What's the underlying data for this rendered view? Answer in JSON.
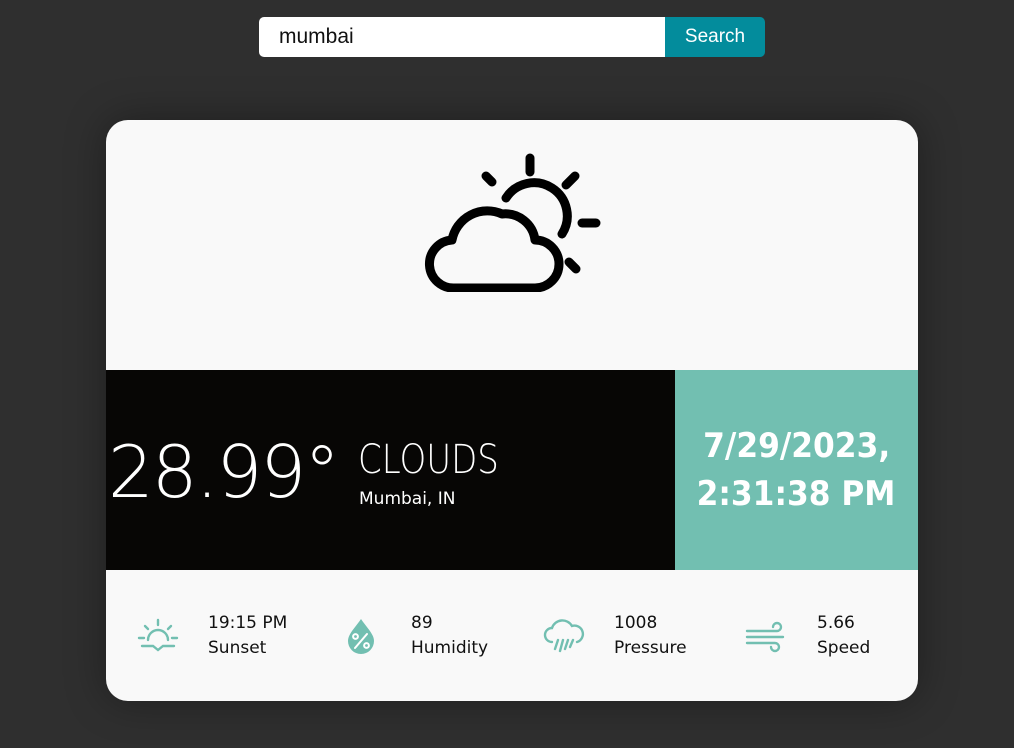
{
  "search": {
    "value": "mumbai",
    "button_label": "Search"
  },
  "weather": {
    "icon": "partly-cloudy-icon",
    "temperature": "28.99°",
    "condition": "CLOUDS",
    "location": "Mumbai, IN",
    "date": "7/29/2023,",
    "time": "2:31:38 PM"
  },
  "stats": [
    {
      "icon": "sunset-icon",
      "value": "19:15 PM",
      "label": "Sunset"
    },
    {
      "icon": "humidity-icon",
      "value": "89",
      "label": "Humidity"
    },
    {
      "icon": "pressure-icon",
      "value": "1008",
      "label": "Pressure"
    },
    {
      "icon": "wind-icon",
      "value": "5.66",
      "label": "Speed"
    }
  ],
  "colors": {
    "background": "#2f2f2f",
    "card": "#f9f9f9",
    "temp_block": "#070605",
    "accent_teal": "#72bfb1",
    "search_button": "#038c9c"
  }
}
